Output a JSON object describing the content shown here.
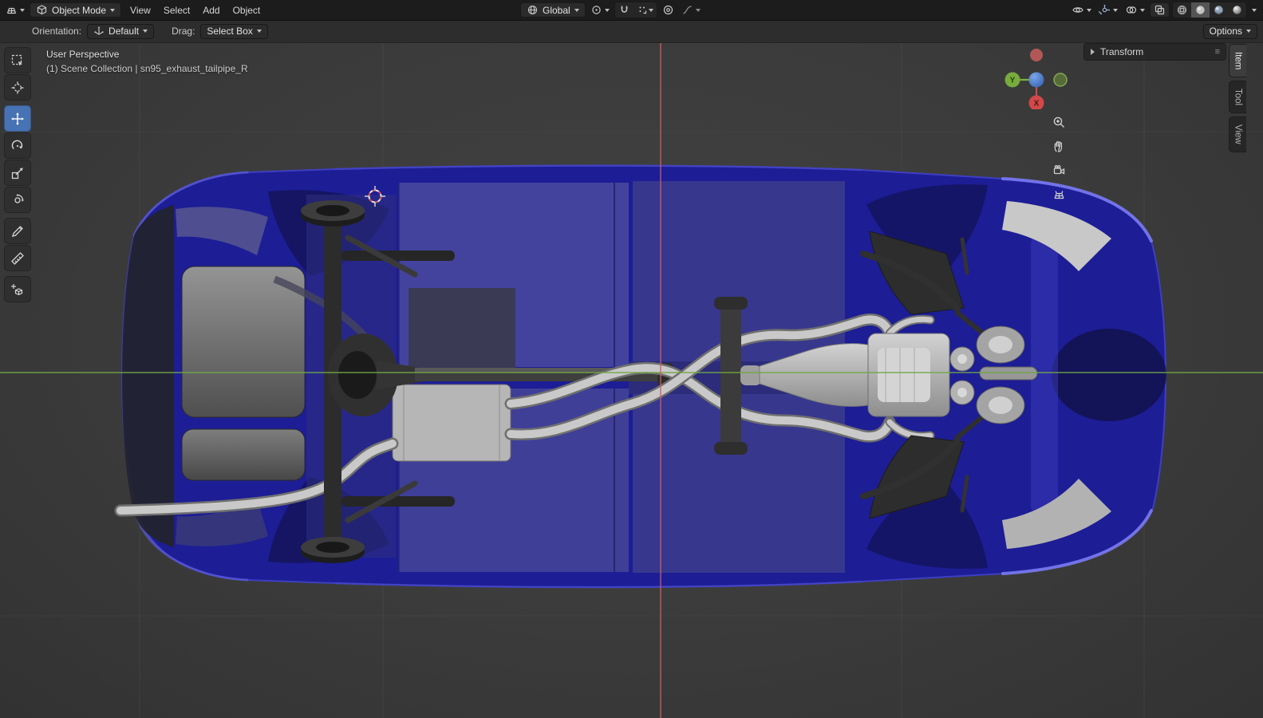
{
  "colors": {
    "accent": "#4772b3",
    "topbar_bg": "#1c1c1c",
    "header_bg": "#2d2d2d",
    "viewport_bg": "#3b3b3b",
    "car_body_blue": "#1d1d96",
    "axis_x": "#cf5f5f",
    "axis_y": "#71a844"
  },
  "topbar": {
    "mode": "Object Mode",
    "menus": [
      {
        "label": "View"
      },
      {
        "label": "Select"
      },
      {
        "label": "Add"
      },
      {
        "label": "Object"
      }
    ],
    "orientation": "Global"
  },
  "tool_settings": {
    "orientation_label": "Orientation:",
    "orientation_value": "Default",
    "drag_label": "Drag:",
    "drag_value": "Select Box",
    "options_label": "Options"
  },
  "viewport": {
    "view_label": "User Perspective",
    "breadcrumb": "(1) Scene Collection | sn95_exhaust_tailpipe_R"
  },
  "gizmo": {
    "x_label": "X",
    "y_label": "Y"
  },
  "toolbar": {
    "tools": [
      "select-box",
      "cursor-3d",
      "move",
      "rotate",
      "scale",
      "transform",
      "annotate",
      "measure",
      "add-cube"
    ],
    "active_tool": "move"
  },
  "sidebar": {
    "panel_title": "Transform",
    "tabs": [
      {
        "label": "Item",
        "active": true
      },
      {
        "label": "Tool",
        "active": false
      },
      {
        "label": "View",
        "active": false
      }
    ]
  }
}
